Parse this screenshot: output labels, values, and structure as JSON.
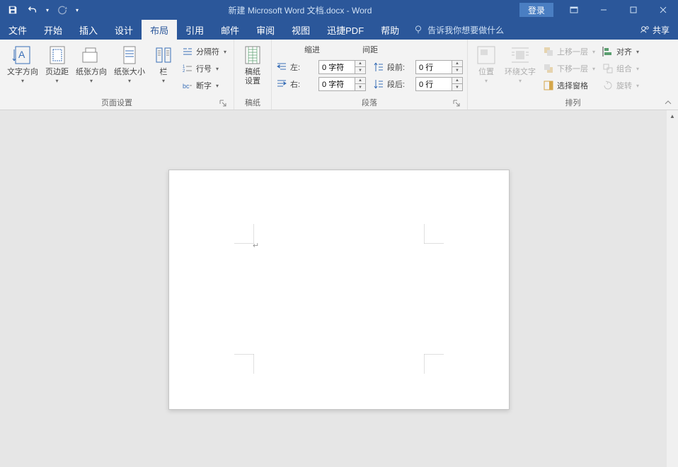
{
  "title": "新建 Microsoft Word 文档.docx - Word",
  "login": "登录",
  "tabs": {
    "file": "文件",
    "home": "开始",
    "insert": "插入",
    "design": "设计",
    "layout": "布局",
    "references": "引用",
    "mailings": "邮件",
    "review": "审阅",
    "view": "视图",
    "pdf": "迅捷PDF",
    "help": "帮助",
    "tellme": "告诉我你想要做什么",
    "share": "共享"
  },
  "ribbon": {
    "page_setup": {
      "label": "页面设置",
      "text_direction": "文字方向",
      "margins": "页边距",
      "orientation": "纸张方向",
      "size": "纸张大小",
      "columns": "栏",
      "breaks": "分隔符",
      "line_numbers": "行号",
      "hyphenation": "断字"
    },
    "paper": {
      "label": "稿纸",
      "settings": "稿纸\n设置"
    },
    "paragraph": {
      "label": "段落",
      "indent": "缩进",
      "spacing": "间距",
      "left": "左:",
      "right": "右:",
      "before": "段前:",
      "after": "段后:",
      "left_val": "0 字符",
      "right_val": "0 字符",
      "before_val": "0 行",
      "after_val": "0 行"
    },
    "arrange": {
      "label": "排列",
      "position": "位置",
      "wrap": "环绕文字",
      "bring_forward": "上移一层",
      "send_backward": "下移一层",
      "selection_pane": "选择窗格",
      "align": "对齐",
      "group": "组合",
      "rotate": "旋转"
    }
  }
}
